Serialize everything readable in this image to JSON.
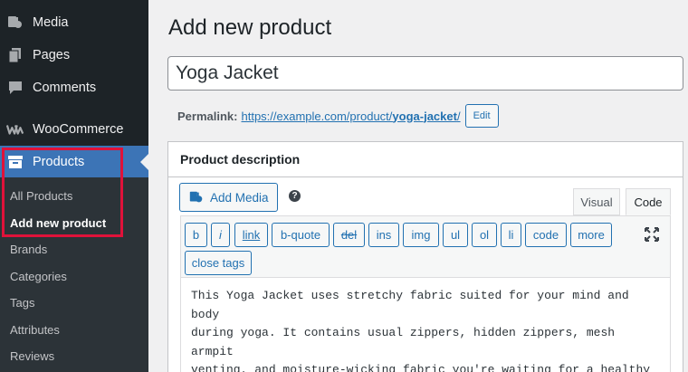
{
  "sidebar": {
    "items": [
      {
        "label": "Media",
        "icon": "media-icon"
      },
      {
        "label": "Pages",
        "icon": "pages-icon"
      },
      {
        "label": "Comments",
        "icon": "comments-icon"
      },
      {
        "label": "WooCommerce",
        "icon": "woocommerce-icon"
      },
      {
        "label": "Products",
        "icon": "products-icon",
        "active": true
      }
    ],
    "submenu": [
      {
        "label": "All Products"
      },
      {
        "label": "Add new product",
        "current": true
      },
      {
        "label": "Brands"
      },
      {
        "label": "Categories"
      },
      {
        "label": "Tags"
      },
      {
        "label": "Attributes"
      },
      {
        "label": "Reviews"
      }
    ]
  },
  "main": {
    "page_title": "Add new product",
    "product_title": "Yoga Jacket",
    "permalink": {
      "label": "Permalink:",
      "base": "https://example.com/product/",
      "slug": "yoga-jacket",
      "trail": "/",
      "edit_label": "Edit"
    },
    "description": {
      "heading": "Product description",
      "add_media_label": "Add Media",
      "help_symbol": "?",
      "tabs": [
        {
          "label": "Visual"
        },
        {
          "label": "Code",
          "active": true
        }
      ],
      "quicktags": [
        "b",
        "i",
        "link",
        "b-quote",
        "del",
        "ins",
        "img",
        "ul",
        "ol",
        "li",
        "code",
        "more",
        "close tags"
      ],
      "content": "This Yoga Jacket uses stretchy fabric suited for your mind and body\nduring yoga. It contains usual zippers, hidden zippers, mesh armpit\nventing, and moisture-wicking fabric you're waiting for a healthy\nlifestyle."
    }
  },
  "colors": {
    "sidebar_bg": "#1d2327",
    "active_bg": "#3c74b6",
    "highlight": "#e0123a",
    "link": "#2271b1"
  }
}
